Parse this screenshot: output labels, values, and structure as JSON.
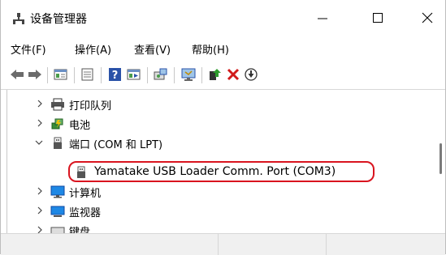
{
  "window": {
    "title": "设备管理器"
  },
  "menu": {
    "file": "文件(F)",
    "action": "操作(A)",
    "view": "查看(V)",
    "help": "帮助(H)"
  },
  "toolbar": {
    "icons": [
      "back-icon",
      "forward-icon",
      "properties-icon",
      "device-list-icon",
      "help-icon",
      "view-icon",
      "scan-icon",
      "monitor-icon",
      "update-driver-icon",
      "uninstall-icon",
      "enable-icon"
    ]
  },
  "tree": {
    "items": [
      {
        "label": "打印队列",
        "icon": "printer-icon",
        "expanded": false
      },
      {
        "label": "电池",
        "icon": "battery-icon",
        "expanded": false
      },
      {
        "label": "端口 (COM 和 LPT)",
        "icon": "port-icon",
        "expanded": true,
        "children": [
          {
            "label": "Yamatake USB Loader Comm. Port (COM3)",
            "icon": "port-device-icon"
          }
        ]
      },
      {
        "label": "计算机",
        "icon": "computer-icon",
        "expanded": false
      },
      {
        "label": "监视器",
        "icon": "monitor-icon",
        "expanded": false
      },
      {
        "label": "键盘",
        "icon": "keyboard-icon",
        "expanded": false
      }
    ]
  },
  "colors": {
    "highlight": "#d9141f",
    "accent": "#1565c0"
  }
}
